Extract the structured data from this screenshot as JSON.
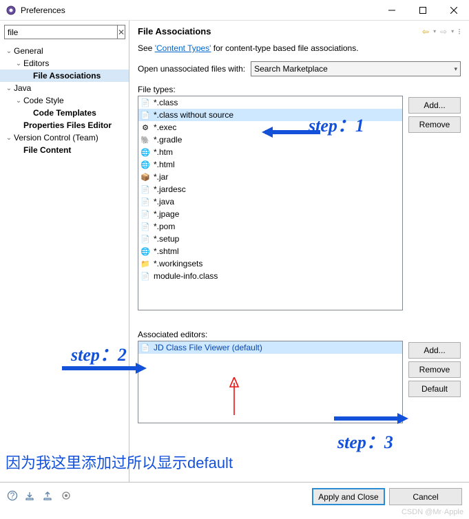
{
  "window": {
    "title": "Preferences"
  },
  "sidebar": {
    "search_value": "file",
    "tree": [
      {
        "label": "General",
        "depth": 1,
        "twisty": "v"
      },
      {
        "label": "Editors",
        "depth": 2,
        "twisty": "v"
      },
      {
        "label": "File Associations",
        "depth": 3,
        "twisty": "",
        "bold": true,
        "sel": true
      },
      {
        "label": "Java",
        "depth": 1,
        "twisty": "v"
      },
      {
        "label": "Code Style",
        "depth": 2,
        "twisty": "v"
      },
      {
        "label": "Code Templates",
        "depth": 3,
        "twisty": "",
        "bold": true
      },
      {
        "label": "Properties Files Editor",
        "depth": 2,
        "twisty": "",
        "bold": true
      },
      {
        "label": "Version Control (Team)",
        "depth": 1,
        "twisty": "v"
      },
      {
        "label": "File Content",
        "depth": 2,
        "twisty": "",
        "bold": true
      }
    ]
  },
  "page": {
    "title": "File Associations",
    "desc_prefix": "See ",
    "desc_link": "'Content Types'",
    "desc_suffix": " for content-type based file associations.",
    "open_label": "Open unassociated files with:",
    "open_value": "Search Marketplace",
    "file_types_label": "File types:",
    "file_types": [
      "*.class",
      "*.class without source",
      "*.exec",
      "*.gradle",
      "*.htm",
      "*.html",
      "*.jar",
      "*.jardesc",
      "*.java",
      "*.jpage",
      "*.pom",
      "*.setup",
      "*.shtml",
      "*.workingsets",
      "module-info.class"
    ],
    "file_types_selected": 1,
    "editors_label": "Associated editors:",
    "editors": [
      "JD Class File Viewer (default)"
    ],
    "editors_selected": 0,
    "btn_add": "Add...",
    "btn_remove": "Remove",
    "btn_default": "Default"
  },
  "footer": {
    "apply": "Apply and Close",
    "cancel": "Cancel"
  },
  "annotations": {
    "step1": "step：1",
    "step2": "step：2",
    "step3": "step：3",
    "chinese": "因为我这里添加过所以显示default"
  },
  "watermark": "CSDN @Mr·Apple"
}
